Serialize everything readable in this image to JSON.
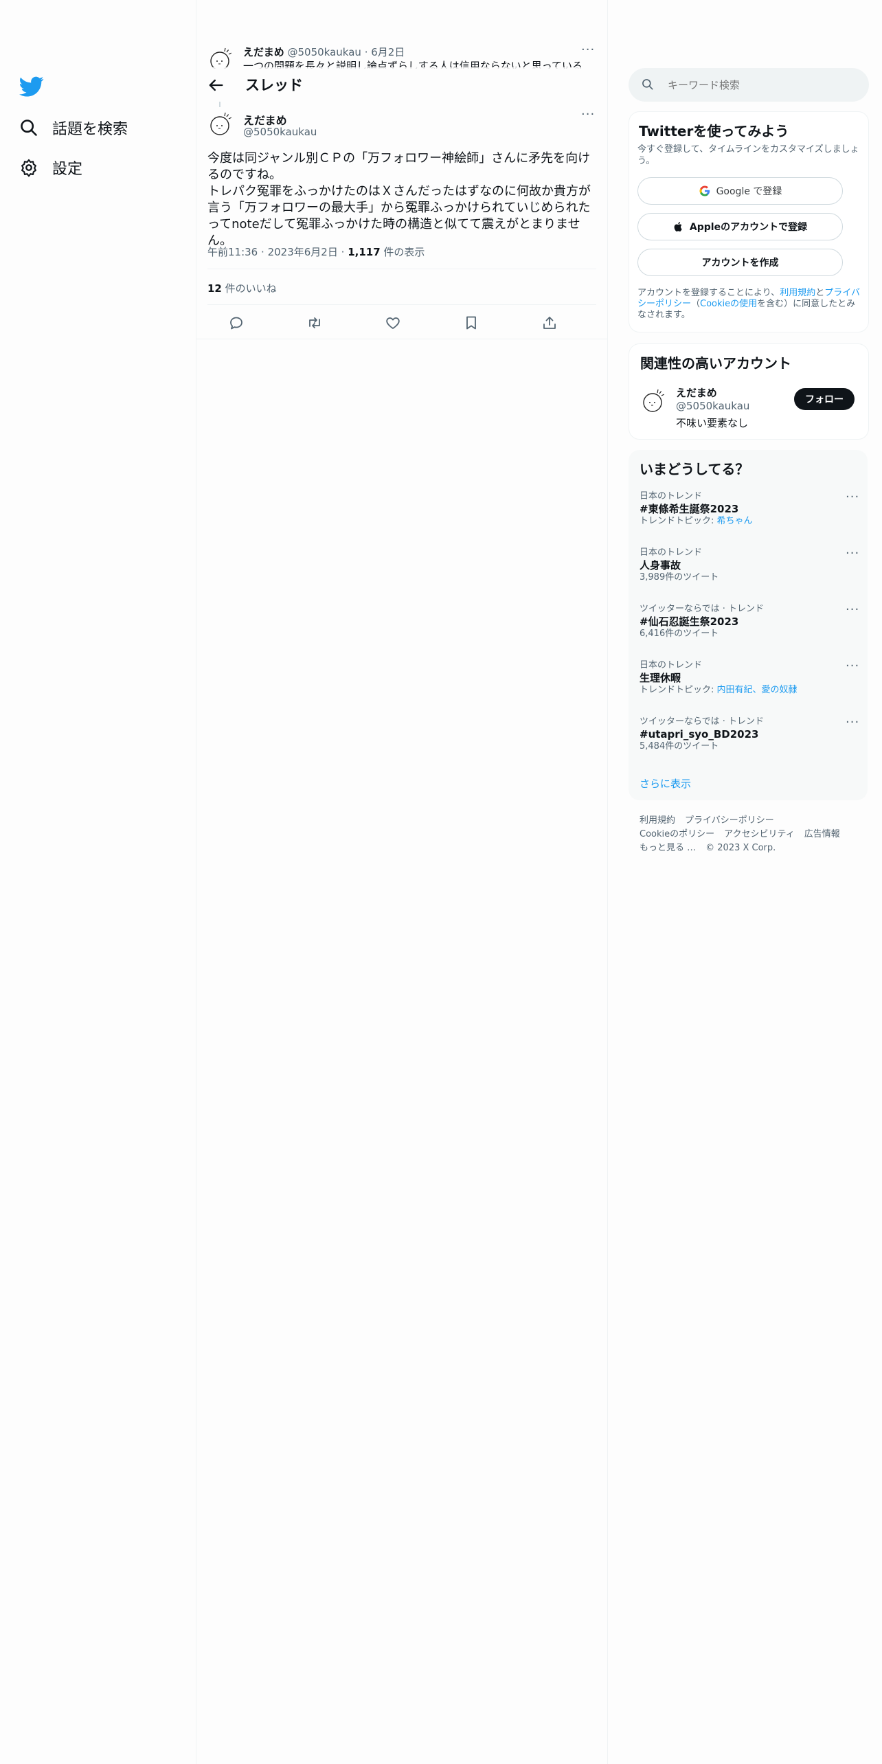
{
  "nav": {
    "search_label": "話題を検索",
    "settings_label": "設定"
  },
  "header": {
    "title": "スレッド"
  },
  "prev_tweet": {
    "name": "えだまめ",
    "handle": "@5050kaukau",
    "sep": "·",
    "date": "6月2日",
    "text": "一つの問題を長々と説明し論点ずらしする人は信用ならないと思っている"
  },
  "tweet": {
    "name": "えだまめ",
    "handle": "@5050kaukau",
    "lines": [
      "今度は同ジャンル別ＣＰの「万フォロワー神絵師」さんに矛先を向けるのですね。",
      "トレパク冤罪をふっかけたのはＸさんだったはずなのに何故か貴方が言う「万フォロワーの最大手」から冤罪ふっかけられていじめられたってnoteだして冤罪ふっかけた時の構造と似てて震えがとまりません。"
    ],
    "time": "午前11:36",
    "sep": "·",
    "date": "2023年6月2日",
    "views_count": "1,117",
    "views_label": " 件の表示",
    "likes_count": "12",
    "likes_label": " 件のいいね"
  },
  "right": {
    "search_placeholder": "キーワード検索",
    "signup": {
      "title": "Twitterを使ってみよう",
      "subtitle": "今すぐ登録して、タイムラインをカスタマイズしましょう。",
      "google_label": "Google で登録",
      "apple_label": "Appleのアカウントで登録",
      "create_label": "アカウントを作成",
      "terms_prefix": "アカウントを登録することにより、",
      "terms_link1": "利用規約",
      "terms_and": "と",
      "terms_link2": "プライバシーポリシー",
      "terms_open": "（",
      "terms_link3": "Cookieの使用",
      "terms_suffix": "を含む）に同意したとみなされます。"
    },
    "related": {
      "title": "関連性の高いアカウント",
      "name": "えだまめ",
      "handle": "@5050kaukau",
      "bio": "不味い要素なし",
      "follow_label": "フォロー"
    },
    "trends": {
      "title": "いまどうしてる？",
      "items": [
        {
          "context": "日本のトレンド",
          "title": "#東條希生誕祭2023",
          "count_prefix": "トレンドトピック: ",
          "count_link": "希ちゃん",
          "count": ""
        },
        {
          "context": "日本のトレンド",
          "title": "人身事故",
          "count_prefix": "",
          "count_link": "",
          "count": "3,989件のツイート"
        },
        {
          "context": "ツイッターならでは · トレンド",
          "title": "#仙石忍誕生祭2023",
          "count_prefix": "",
          "count_link": "",
          "count": "6,416件のツイート"
        },
        {
          "context": "日本のトレンド",
          "title": "生理休暇",
          "count_prefix": "トレンドトピック: ",
          "count_link": "内田有紀、愛の奴隷",
          "count": ""
        },
        {
          "context": "ツイッターならでは · トレンド",
          "title": "#utapri_syo_BD2023",
          "count_prefix": "",
          "count_link": "",
          "count": "5,484件のツイート"
        }
      ],
      "show_more": "さらに表示"
    },
    "footer": {
      "terms": "利用規約",
      "privacy": "プライバシーポリシー",
      "cookie": "Cookieのポリシー",
      "accessibility": "アクセシビリティ",
      "ads": "広告情報",
      "more": "もっと見る …",
      "copyright": "© 2023 X Corp."
    }
  },
  "colors": {
    "accent": "#1d9bf0",
    "text": "#0f1419",
    "muted": "#536471",
    "border": "#eff3f4"
  }
}
